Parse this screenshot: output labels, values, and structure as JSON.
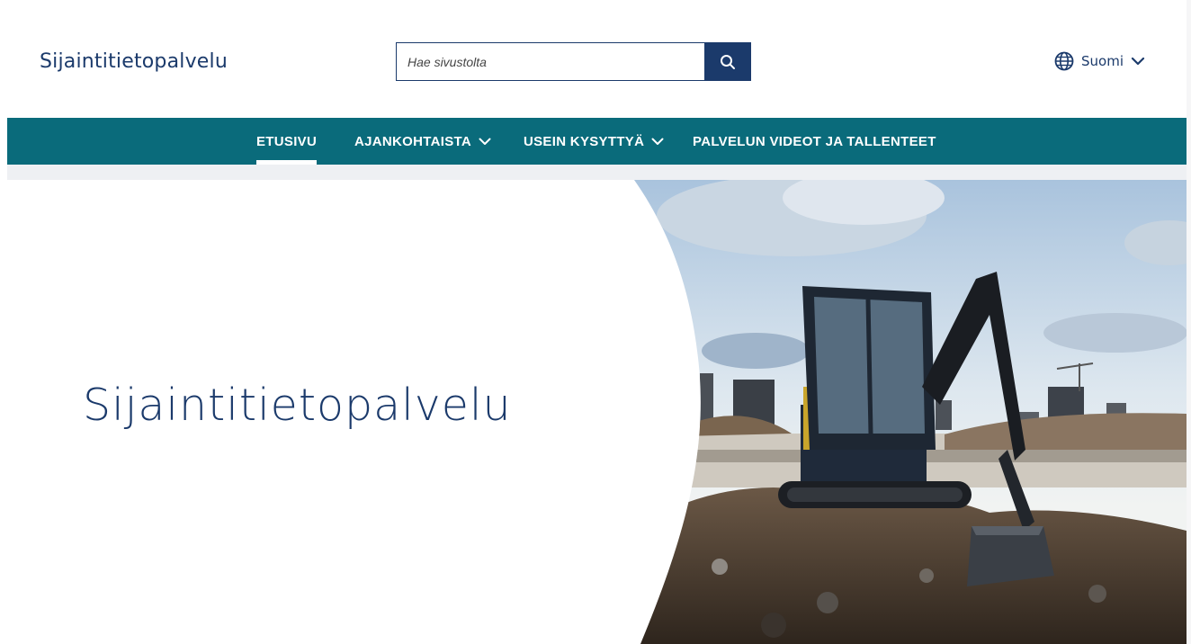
{
  "header": {
    "logo_text": "Sijaintitietopalvelu",
    "search": {
      "placeholder": "Hae sivustolta",
      "button_icon": "search-icon"
    },
    "language": {
      "label": "Suomi",
      "icon": "globe-icon",
      "chevron_icon": "chevron-down-icon"
    }
  },
  "nav": {
    "items": [
      {
        "label": "ETUSIVU",
        "active": true,
        "has_dropdown": false
      },
      {
        "label": "AJANKOHTAISTA",
        "active": false,
        "has_dropdown": true
      },
      {
        "label": "USEIN KYSYTTYÄ",
        "active": false,
        "has_dropdown": true
      },
      {
        "label": "PALVELUN VIDEOT JA TALLENTEET",
        "active": false,
        "has_dropdown": false
      }
    ]
  },
  "hero": {
    "title": "Sijaintitietopalvelu",
    "image_subject": "excavator-at-construction-site"
  },
  "colors": {
    "brand_navy": "#1b3a6b",
    "nav_teal": "#0a6b7b",
    "subbar_grey": "#eef0f3"
  }
}
